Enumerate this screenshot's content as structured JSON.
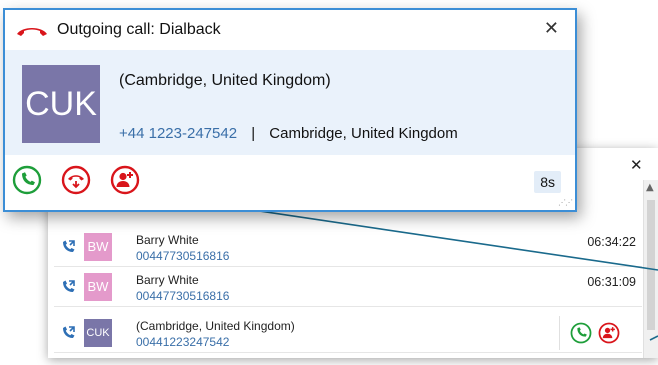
{
  "popup": {
    "title": "Outgoing call: Dialback",
    "close_icon": "close-icon",
    "avatar_initials": "CUK",
    "contact_name": "(Cambridge, United Kingdom)",
    "phone_number": "+44 1223-247542",
    "separator": "|",
    "location": "Cambridge, United Kingdom",
    "timer": "8s",
    "colors": {
      "border": "#3c8ed6",
      "card_bg": "#eaf2fb",
      "avatar": "#7a76a8",
      "answer": "#1e9e3a",
      "hangup": "#d9151b"
    }
  },
  "window": {
    "minimize_icon": "minimize-icon",
    "maximize_icon": "maximize-icon",
    "close_icon": "close-icon"
  },
  "call_list": [
    {
      "initials": "BW",
      "name": "Barry White",
      "number": "00447730516816",
      "time": "06:34:22",
      "avatar_color": "#e49acb"
    },
    {
      "initials": "BW",
      "name": "Barry White",
      "number": "00447730516816",
      "time": "06:31:09",
      "avatar_color": "#e49acb"
    },
    {
      "initials": "CUK",
      "name": "(Cambridge, United Kingdom)",
      "number": "00441223247542",
      "time": "",
      "avatar_color": "#7a76a8"
    }
  ]
}
